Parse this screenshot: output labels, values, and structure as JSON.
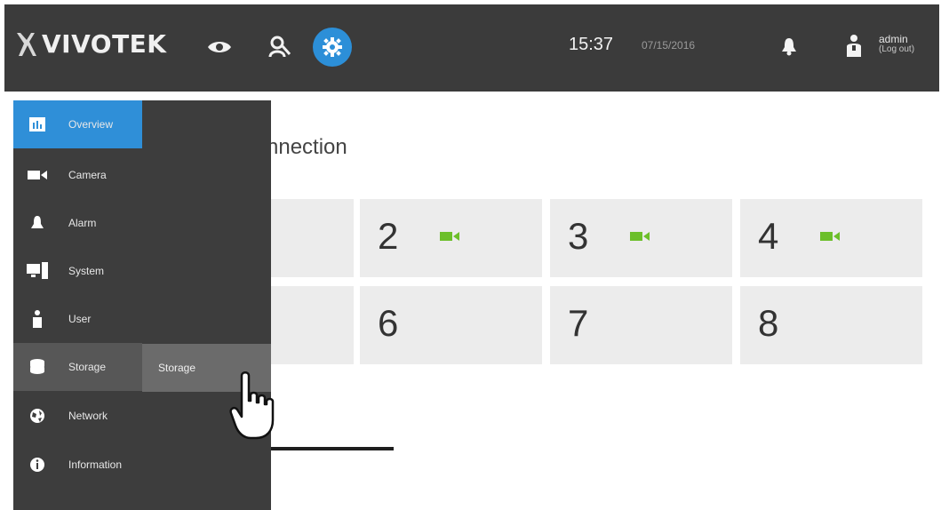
{
  "header": {
    "brand": "VIVOTEK",
    "time": "15:37",
    "date": "07/15/2016",
    "user": "admin",
    "logout_label": "(Log out)",
    "icons": [
      "eye-icon",
      "search-person-icon",
      "settings-icon",
      "bell-icon",
      "user-icon"
    ],
    "active_color": "#2c8fd8"
  },
  "sidebar": {
    "items": [
      {
        "label": "Overview",
        "icon": "overview-icon"
      },
      {
        "label": "Camera",
        "icon": "camera-icon"
      },
      {
        "label": "Alarm",
        "icon": "alarm-icon"
      },
      {
        "label": "System",
        "icon": "system-icon"
      },
      {
        "label": "User",
        "icon": "user-icon"
      },
      {
        "label": "Storage",
        "icon": "storage-icon"
      },
      {
        "label": "Network",
        "icon": "network-icon"
      },
      {
        "label": "Information",
        "icon": "information-icon"
      }
    ],
    "active": "Overview",
    "hovered": "Storage"
  },
  "submenu": {
    "items": [
      {
        "label": "Storage"
      }
    ]
  },
  "main": {
    "title_fragment": "nnection",
    "tiles": [
      "2",
      "3",
      "4",
      "6",
      "7",
      "8"
    ],
    "camera_status_color": "#6cbf2a"
  }
}
